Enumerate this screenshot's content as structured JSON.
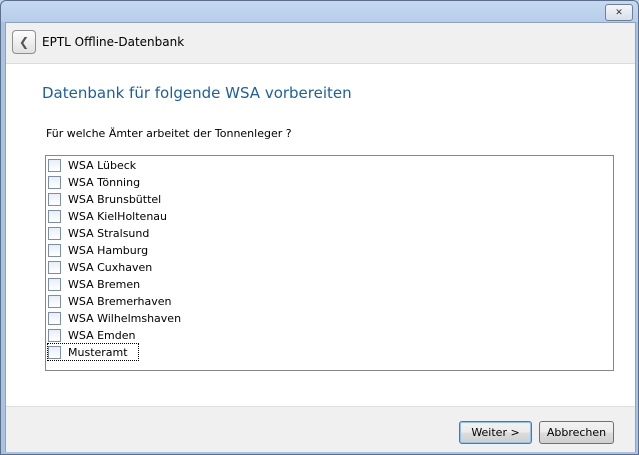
{
  "window": {
    "close_glyph": "✕"
  },
  "header": {
    "back_glyph": "❮",
    "title": "EPTL Offline-Datenbank"
  },
  "page": {
    "title": "Datenbank für folgende WSA vorbereiten",
    "question": "Für welche Ämter arbeitet der Tonnenleger ?"
  },
  "list": {
    "items": [
      {
        "label": "WSA Lübeck",
        "checked": false
      },
      {
        "label": "WSA Tönning",
        "checked": false
      },
      {
        "label": "WSA Brunsbüttel",
        "checked": false
      },
      {
        "label": "WSA KielHoltenau",
        "checked": false
      },
      {
        "label": "WSA Stralsund",
        "checked": false
      },
      {
        "label": "WSA Hamburg",
        "checked": false
      },
      {
        "label": "WSA Cuxhaven",
        "checked": false
      },
      {
        "label": "WSA Bremen",
        "checked": false
      },
      {
        "label": "WSA Bremerhaven",
        "checked": false
      },
      {
        "label": "WSA Wilhelmshaven",
        "checked": false
      },
      {
        "label": "WSA Emden",
        "checked": false
      },
      {
        "label": "Musteramt",
        "checked": false,
        "focused": true
      }
    ]
  },
  "footer": {
    "next_label": "Weiter >",
    "cancel_label": "Abbrechen"
  },
  "icons": {
    "back": "back-arrow-icon",
    "close": "close-icon"
  },
  "colors": {
    "title_blue": "#1c5fa4",
    "window_frame": "#b7cde9",
    "client_bg": "#f0f0f0"
  }
}
